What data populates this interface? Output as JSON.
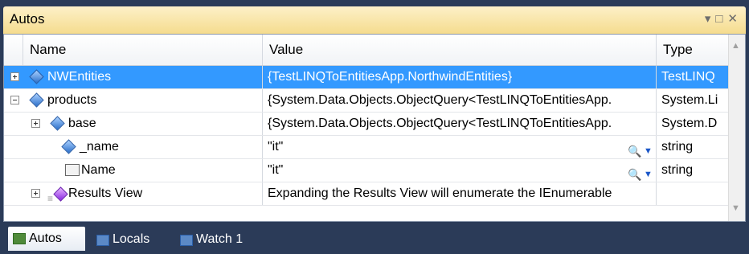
{
  "window": {
    "title": "Autos"
  },
  "columns": {
    "name": "Name",
    "value": "Value",
    "type": "Type"
  },
  "rows": [
    {
      "name": "NWEntities",
      "value": "{TestLINQToEntitiesApp.NorthwindEntities}",
      "type": "TestLINQ",
      "selected": true,
      "icon": "field-gem-icon",
      "expander": "plus"
    },
    {
      "name": "products",
      "value": "{System.Data.Objects.ObjectQuery<TestLINQToEntitiesApp.",
      "type": "System.Li",
      "icon": "field-gem-icon",
      "expander": "minus"
    },
    {
      "name": "base",
      "value": "{System.Data.Objects.ObjectQuery<TestLINQToEntitiesApp.",
      "type": "System.D",
      "icon": "field-gem-icon",
      "expander": "plus"
    },
    {
      "name": "_name",
      "value": "\"it\"",
      "type": "string",
      "icon": "private-field-icon"
    },
    {
      "name": "Name",
      "value": "\"it\"",
      "type": "string",
      "icon": "property-icon"
    },
    {
      "name": "Results View",
      "value": "Expanding the Results View will enumerate the IEnumerable",
      "type": "",
      "icon": "results-view-icon",
      "expander": "plus"
    }
  ],
  "tabs": [
    {
      "label": "Autos",
      "active": true
    },
    {
      "label": "Locals",
      "active": false
    },
    {
      "label": "Watch 1",
      "active": false
    }
  ],
  "colors": {
    "selection": "#3399ff",
    "title_bar": "#f5dc8e",
    "frame": "#2b3b58"
  }
}
